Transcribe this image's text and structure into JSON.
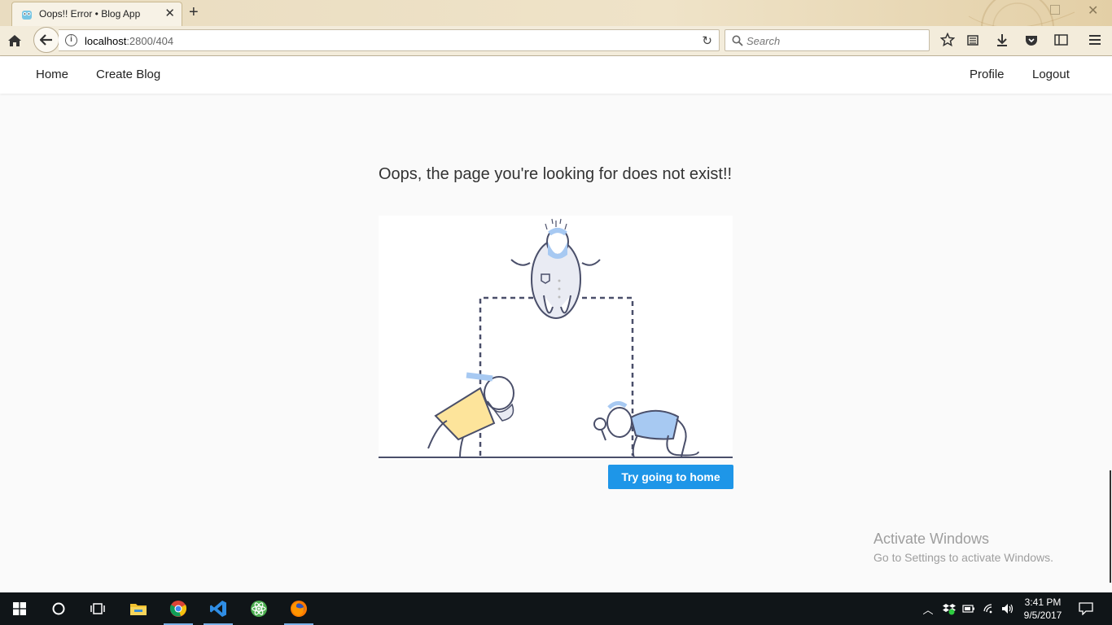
{
  "browser": {
    "tab_title": "Oops!! Error • Blog App",
    "new_tab_symbol": "+",
    "url_host": "localhost",
    "url_path": ":2800/404",
    "search_placeholder": "Search"
  },
  "app_nav": {
    "home": "Home",
    "create_blog": "Create Blog",
    "profile": "Profile",
    "logout": "Logout"
  },
  "main": {
    "message": "Oops, the page you're looking for does not exist!!",
    "home_button": "Try going to home"
  },
  "watermark": {
    "title": "Activate Windows",
    "subtitle": "Go to Settings to activate Windows."
  },
  "taskbar": {
    "time": "3:41 PM",
    "date": "9/5/2017"
  },
  "colors": {
    "accent": "#1e96e8",
    "illustration_blue": "#a7c9f2",
    "illustration_yellow": "#fde49b"
  }
}
